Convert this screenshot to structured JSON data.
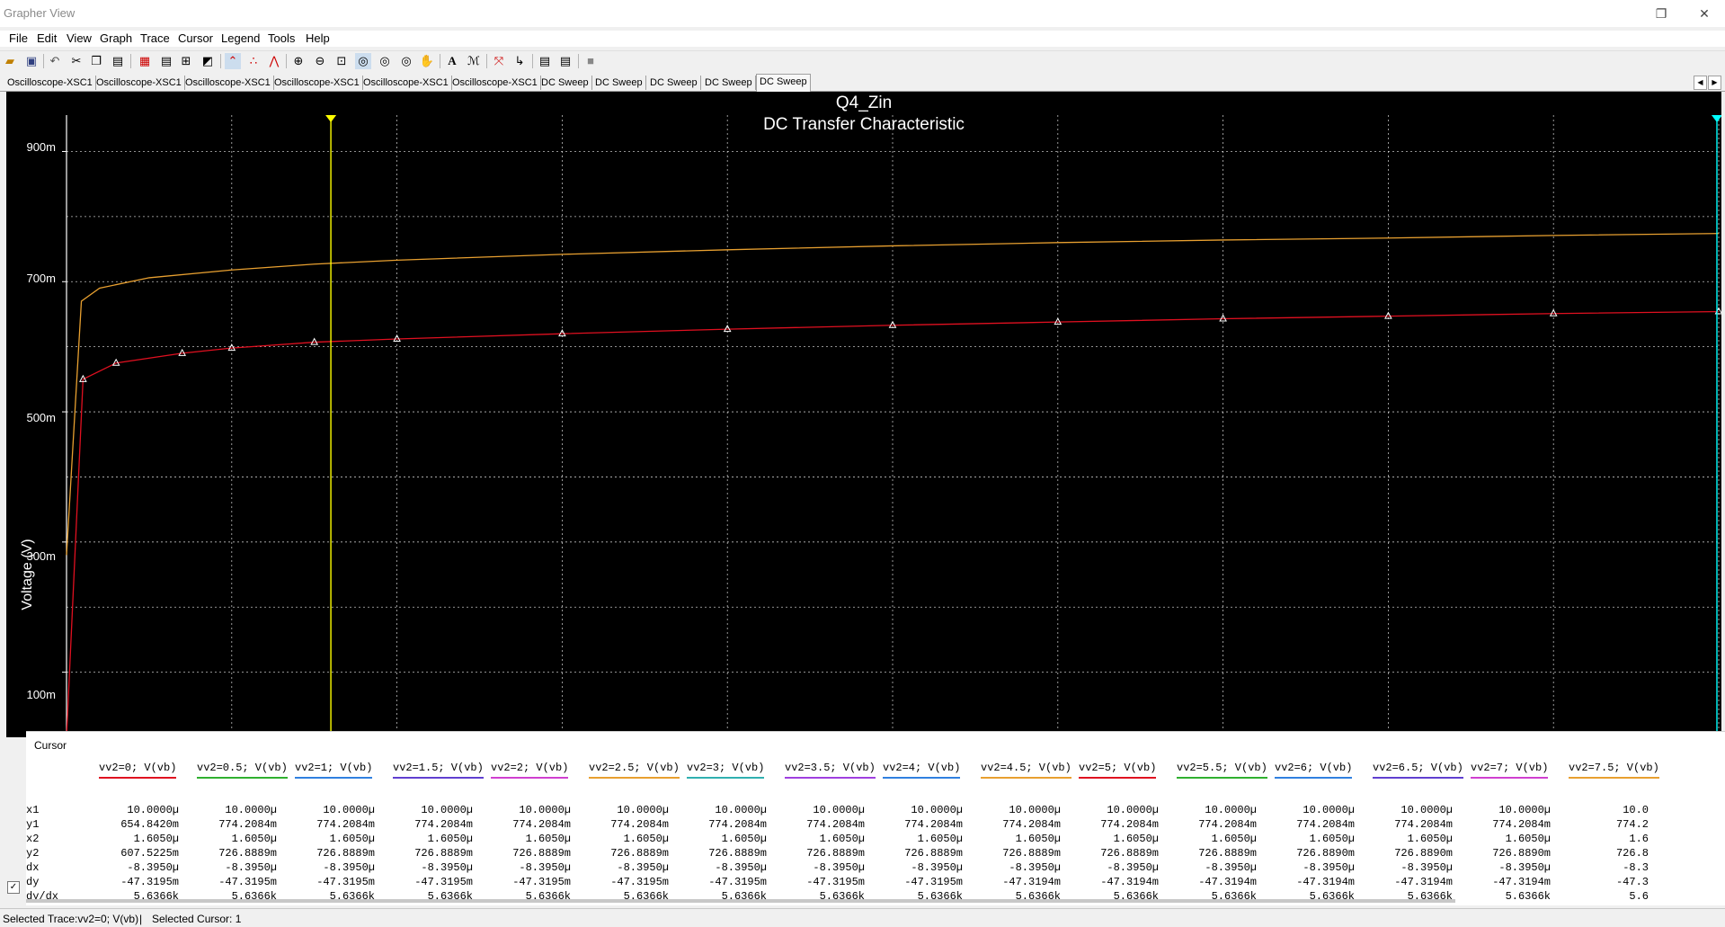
{
  "window": {
    "title": "Grapher View",
    "restore_icon": "restore-icon",
    "close_icon": "close-icon"
  },
  "menu": [
    "File",
    "Edit",
    "View",
    "Graph",
    "Trace",
    "Cursor",
    "Legend",
    "Tools",
    "Help"
  ],
  "toolbar_icons": [
    "open-icon",
    "save-icon",
    "undo-icon",
    "cut-icon",
    "copy-icon",
    "paste-icon",
    "grid-icon",
    "legend-icon",
    "cursors-icon",
    "reverse-colors-icon",
    "line-icon",
    "dots-icon",
    "dots-lines-icon",
    "zoom-in-icon",
    "zoom-out-icon",
    "zoom-area-icon",
    "zoom-x-icon",
    "zoom-y-icon",
    "zoom-full-icon",
    "pan-icon",
    "text-icon",
    "title-icon",
    "overlay-icon",
    "export-icon",
    "add-trace-icon",
    "stop-icon"
  ],
  "tabs": [
    "Oscilloscope-XSC1",
    "Oscilloscope-XSC1",
    "Oscilloscope-XSC1",
    "Oscilloscope-XSC1",
    "Oscilloscope-XSC1",
    "Oscilloscope-XSC1",
    "DC Sweep",
    "DC Sweep",
    "DC Sweep",
    "DC Sweep",
    "DC Sweep"
  ],
  "active_tab": 10,
  "graph": {
    "title": "Q4_Zin",
    "subtitle": "DC Transfer Characteristic",
    "ylabel": "Voltage (V)",
    "ytick_labels": [
      "900m",
      "700m",
      "500m",
      "300m",
      "100m"
    ],
    "background": "#000000",
    "grid_color": "#ffffff",
    "cursor1_color": "#ffff00",
    "cursor2_color": "#00ffff"
  },
  "chart_data": {
    "type": "line",
    "title": "Q4_Zin",
    "subtitle": "DC Transfer Characteristic",
    "xlabel": "",
    "ylabel": "Voltage (V)",
    "ylim": [
      0.0,
      0.92
    ],
    "xlim": [
      0.0,
      1.0
    ],
    "grid": true,
    "series": [
      {
        "name": "vv2=0; V(vb)",
        "color": "#e01020",
        "marker": "triangle",
        "x": [
          0.0,
          0.01,
          0.03,
          0.07,
          0.1,
          0.15,
          0.2,
          0.3,
          0.4,
          0.5,
          0.6,
          0.7,
          0.8,
          0.9,
          1.0
        ],
        "y": [
          0.0,
          0.55,
          0.575,
          0.59,
          0.598,
          0.607,
          0.612,
          0.62,
          0.627,
          0.633,
          0.638,
          0.643,
          0.647,
          0.651,
          0.654
        ]
      },
      {
        "name": "vv2=0.5; V(vb)",
        "color": "#e8a030",
        "marker": "none",
        "x": [
          0.0,
          0.009,
          0.02,
          0.05,
          0.1,
          0.15,
          0.2,
          0.3,
          0.4,
          0.5,
          0.6,
          0.7,
          0.8,
          0.9,
          1.0
        ],
        "y": [
          0.28,
          0.67,
          0.69,
          0.706,
          0.718,
          0.727,
          0.733,
          0.742,
          0.749,
          0.755,
          0.76,
          0.764,
          0.767,
          0.771,
          0.774
        ]
      }
    ],
    "cursors": [
      {
        "label": "1",
        "x": 0.16
      },
      {
        "label": "2",
        "x": 1.0
      }
    ]
  },
  "cursor_panel": {
    "title": "Cursor",
    "row_labels": [
      "x1",
      "y1",
      "x2",
      "y2",
      "dx",
      "dy",
      "dy/dx"
    ],
    "columns": [
      {
        "name": "vv2=0; V(vb)",
        "color": "#e01020",
        "values": [
          "10.0000µ",
          "654.8420m",
          "1.6050µ",
          "607.5225m",
          "-8.3950µ",
          "-47.3195m",
          "5.6366k"
        ]
      },
      {
        "name": "vv2=0.5; V(vb)",
        "color": "#30b030",
        "values": [
          "10.0000µ",
          "774.2084m",
          "1.6050µ",
          "726.8889m",
          "-8.3950µ",
          "-47.3195m",
          "5.6366k"
        ]
      },
      {
        "name": "vv2=1; V(vb)",
        "color": "#3080e0",
        "values": [
          "10.0000µ",
          "774.2084m",
          "1.6050µ",
          "726.8889m",
          "-8.3950µ",
          "-47.3195m",
          "5.6366k"
        ]
      },
      {
        "name": "vv2=1.5; V(vb)",
        "color": "#6040d0",
        "values": [
          "10.0000µ",
          "774.2084m",
          "1.6050µ",
          "726.8889m",
          "-8.3950µ",
          "-47.3195m",
          "5.6366k"
        ]
      },
      {
        "name": "vv2=2; V(vb)",
        "color": "#d040d0",
        "values": [
          "10.0000µ",
          "774.2084m",
          "1.6050µ",
          "726.8889m",
          "-8.3950µ",
          "-47.3195m",
          "5.6366k"
        ]
      },
      {
        "name": "vv2=2.5; V(vb)",
        "color": "#e8a030",
        "values": [
          "10.0000µ",
          "774.2084m",
          "1.6050µ",
          "726.8889m",
          "-8.3950µ",
          "-47.3195m",
          "5.6366k"
        ]
      },
      {
        "name": "vv2=3; V(vb)",
        "color": "#30b0b0",
        "values": [
          "10.0000µ",
          "774.2084m",
          "1.6050µ",
          "726.8889m",
          "-8.3950µ",
          "-47.3195m",
          "5.6366k"
        ]
      },
      {
        "name": "vv2=3.5; V(vb)",
        "color": "#a040e0",
        "values": [
          "10.0000µ",
          "774.2084m",
          "1.6050µ",
          "726.8889m",
          "-8.3950µ",
          "-47.3195m",
          "5.6366k"
        ]
      },
      {
        "name": "vv2=4; V(vb)",
        "color": "#3080e0",
        "values": [
          "10.0000µ",
          "774.2084m",
          "1.6050µ",
          "726.8889m",
          "-8.3950µ",
          "-47.3195m",
          "5.6366k"
        ]
      },
      {
        "name": "vv2=4.5; V(vb)",
        "color": "#e8a030",
        "values": [
          "10.0000µ",
          "774.2084m",
          "1.6050µ",
          "726.8889m",
          "-8.3950µ",
          "-47.3194m",
          "5.6366k"
        ]
      },
      {
        "name": "vv2=5; V(vb)",
        "color": "#e01020",
        "values": [
          "10.0000µ",
          "774.2084m",
          "1.6050µ",
          "726.8889m",
          "-8.3950µ",
          "-47.3194m",
          "5.6366k"
        ]
      },
      {
        "name": "vv2=5.5; V(vb)",
        "color": "#30b030",
        "values": [
          "10.0000µ",
          "774.2084m",
          "1.6050µ",
          "726.8889m",
          "-8.3950µ",
          "-47.3194m",
          "5.6366k"
        ]
      },
      {
        "name": "vv2=6; V(vb)",
        "color": "#3080e0",
        "values": [
          "10.0000µ",
          "774.2084m",
          "1.6050µ",
          "726.8890m",
          "-8.3950µ",
          "-47.3194m",
          "5.6366k"
        ]
      },
      {
        "name": "vv2=6.5; V(vb)",
        "color": "#6040d0",
        "values": [
          "10.0000µ",
          "774.2084m",
          "1.6050µ",
          "726.8890m",
          "-8.3950µ",
          "-47.3194m",
          "5.6366k"
        ]
      },
      {
        "name": "vv2=7; V(vb)",
        "color": "#d040d0",
        "values": [
          "10.0000µ",
          "774.2084m",
          "1.6050µ",
          "726.8890m",
          "-8.3950µ",
          "-47.3194m",
          "5.6366k"
        ]
      },
      {
        "name": "vv2=7.5; V(vb)",
        "color": "#e8a030",
        "values": [
          "10.0",
          "774.2",
          "1.6",
          "726.8",
          "-8.3",
          "-47.3",
          "5.6"
        ]
      }
    ]
  },
  "status": {
    "trace": "Selected Trace:vv2=0; V(vb)",
    "sep": "|",
    "cursor": "Selected Cursor: 1"
  }
}
